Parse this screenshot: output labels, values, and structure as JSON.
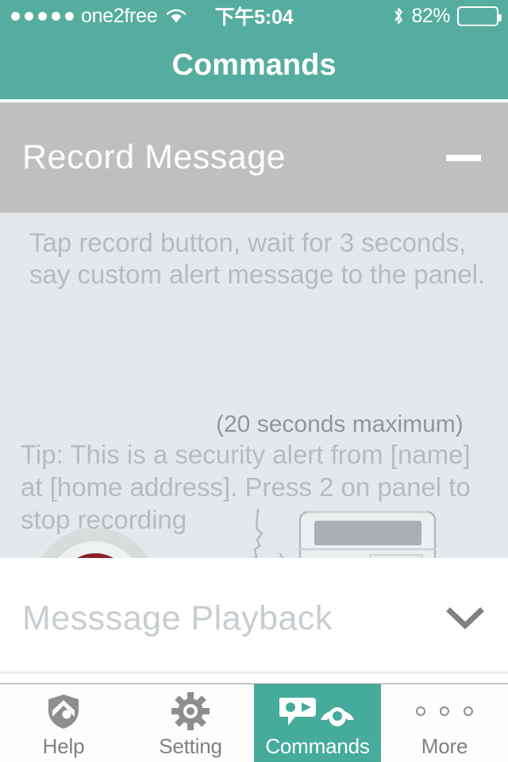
{
  "status_bar": {
    "signal_dots": 5,
    "carrier": "one2free",
    "wifi_icon": "wifi-icon",
    "time": "下午5:04",
    "bluetooth_icon": "bluetooth-icon",
    "battery_percent": "82%",
    "battery_level": 82
  },
  "nav": {
    "title": "Commands"
  },
  "sections": {
    "record": {
      "title": "Record Message",
      "toggle_icon": "minus-icon",
      "expanded": true,
      "instructions": "Tap record button, wait for 3 seconds, say custom alert message to the panel.",
      "record_button_icon": "record-button",
      "illustration_icon": "person-speaking-to-panel-illustration",
      "caption": "(20 seconds maximum)",
      "tip": "Tip: This is a security alert from [name] at [home address]. Press 2 on panel to stop recording"
    },
    "playback": {
      "title": "Messsage Playback",
      "toggle_icon": "chevron-down-icon",
      "expanded": false
    }
  },
  "tabbar": {
    "items": [
      {
        "label": "Help",
        "icon": "shield-icon",
        "active": false
      },
      {
        "label": "Setting",
        "icon": "gear-icon",
        "active": false
      },
      {
        "label": "Commands",
        "icon": "speech-bubble-phone-icon",
        "active": true
      },
      {
        "label": "More",
        "icon": "ellipsis-icon",
        "active": false
      }
    ]
  },
  "colors": {
    "teal_header": "#55ad9f",
    "teal_tab_active": "#46ab9b",
    "section_header_gray": "#bfbfbf",
    "panel_background": "#e4e8ea",
    "record_red": "#8c2229",
    "muted_text": "#b4bcc0"
  }
}
